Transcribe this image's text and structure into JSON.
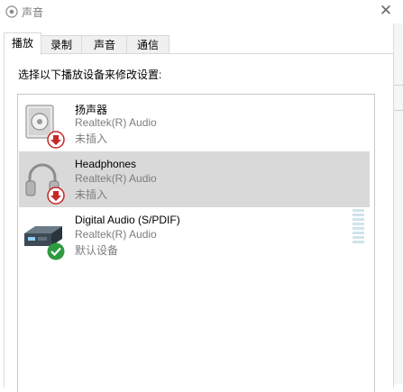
{
  "window": {
    "title": "声音"
  },
  "tabs": [
    {
      "label": "播放",
      "active": true
    },
    {
      "label": "录制",
      "active": false
    },
    {
      "label": "声音",
      "active": false
    },
    {
      "label": "通信",
      "active": false
    }
  ],
  "instruction": "选择以下播放设备来修改设置:",
  "devices": [
    {
      "name": "扬声器",
      "driver": "Realtek(R) Audio",
      "status": "未插入",
      "icon": "speaker-icon",
      "badge": "unplugged-arrow-icon",
      "selected": false
    },
    {
      "name": "Headphones",
      "driver": "Realtek(R) Audio",
      "status": "未插入",
      "icon": "headphones-icon",
      "badge": "unplugged-arrow-icon",
      "selected": true
    },
    {
      "name": "Digital Audio (S/PDIF)",
      "driver": "Realtek(R) Audio",
      "status": "默认设备",
      "icon": "digital-audio-device-icon",
      "badge": "default-check-icon",
      "selected": false
    }
  ],
  "colors": {
    "unplugged_badge": "#c62828",
    "default_badge": "#2e9a3f",
    "selection": "#d9d9d9",
    "meter": "#cfe3ea"
  }
}
